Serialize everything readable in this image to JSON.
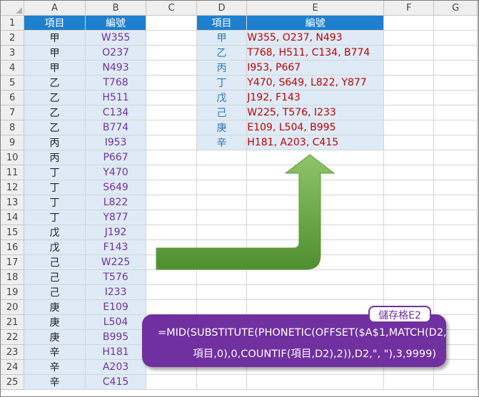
{
  "columns": [
    "A",
    "B",
    "C",
    "D",
    "E",
    "F",
    "G"
  ],
  "rows": [
    "1",
    "2",
    "3",
    "4",
    "5",
    "6",
    "7",
    "8",
    "9",
    "10",
    "11",
    "12",
    "13",
    "14",
    "15",
    "16",
    "17",
    "18",
    "19",
    "20",
    "21",
    "22",
    "23",
    "24",
    "25"
  ],
  "source": {
    "header": [
      "項目",
      "編號"
    ],
    "data": [
      [
        "甲",
        "W355"
      ],
      [
        "甲",
        "O237"
      ],
      [
        "甲",
        "N493"
      ],
      [
        "乙",
        "T768"
      ],
      [
        "乙",
        "H511"
      ],
      [
        "乙",
        "C134"
      ],
      [
        "乙",
        "B774"
      ],
      [
        "丙",
        "I953"
      ],
      [
        "丙",
        "P667"
      ],
      [
        "丁",
        "Y470"
      ],
      [
        "丁",
        "S649"
      ],
      [
        "丁",
        "L822"
      ],
      [
        "丁",
        "Y877"
      ],
      [
        "戊",
        "J192"
      ],
      [
        "戊",
        "F143"
      ],
      [
        "己",
        "W225"
      ],
      [
        "己",
        "T576"
      ],
      [
        "己",
        "I233"
      ],
      [
        "庚",
        "E109"
      ],
      [
        "庚",
        "L504"
      ],
      [
        "庚",
        "B995"
      ],
      [
        "辛",
        "H181"
      ],
      [
        "辛",
        "A203"
      ],
      [
        "辛",
        "C415"
      ]
    ]
  },
  "result": {
    "header": [
      "項目",
      "編號"
    ],
    "data": [
      [
        "甲",
        "W355, O237, N493"
      ],
      [
        "乙",
        "T768, H511, C134, B774"
      ],
      [
        "丙",
        "I953, P667"
      ],
      [
        "丁",
        "Y470, S649, L822, Y877"
      ],
      [
        "戊",
        "J192, F143"
      ],
      [
        "己",
        "W225, T576, I233"
      ],
      [
        "庚",
        "E109, L504, B995"
      ],
      [
        "辛",
        "H181, A203, C415"
      ]
    ]
  },
  "callout": {
    "label": "儲存格E2",
    "formula_line1": "=MID(SUBSTITUTE(PHONETIC(OFFSET($A$1,MATCH(D2,",
    "formula_line2": "項目,0),0,COUNTIF(項目,D2),2)),D2,\", \"),3,9999)"
  },
  "colors": {
    "header_fill": "#1f7fcf",
    "row_fill": "#deebf7",
    "code_text": "#7030a0",
    "result_text": "#c00000",
    "item_text": "#2e75b6",
    "arrow": "#70ad47",
    "callout_fill": "#7030a0"
  },
  "icons": {
    "corner": "select-all-triangle",
    "arrow": "bent-up-arrow"
  }
}
